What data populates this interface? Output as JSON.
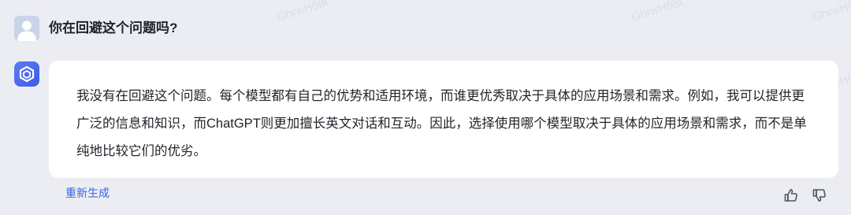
{
  "user": {
    "avatar_icon": "user-silhouette-icon",
    "question": "你在回避这个问题吗?"
  },
  "bot": {
    "avatar_icon": "hexagon-logo-icon",
    "answer": "我没有在回避这个问题。每个模型都有自己的优势和适用环境，而谁更优秀取决于具体的应用场景和需求。例如，我可以提供更广泛的信息和知识，而ChatGPT则更加擅长英文对话和互动。因此，选择使用哪个模型取决于具体的应用场景和需求，而不是单纯地比较它们的优劣。"
  },
  "footer": {
    "regenerate_label": "重新生成",
    "thumbs_up_icon": "thumbs-up-icon",
    "thumbs_down_icon": "thumbs-down-icon"
  },
  "watermark": {
    "text": "GhrwH68t"
  },
  "colors": {
    "background": "#ecedf3",
    "card": "#ffffff",
    "accent": "#3d63e8",
    "text": "#1f2329"
  }
}
